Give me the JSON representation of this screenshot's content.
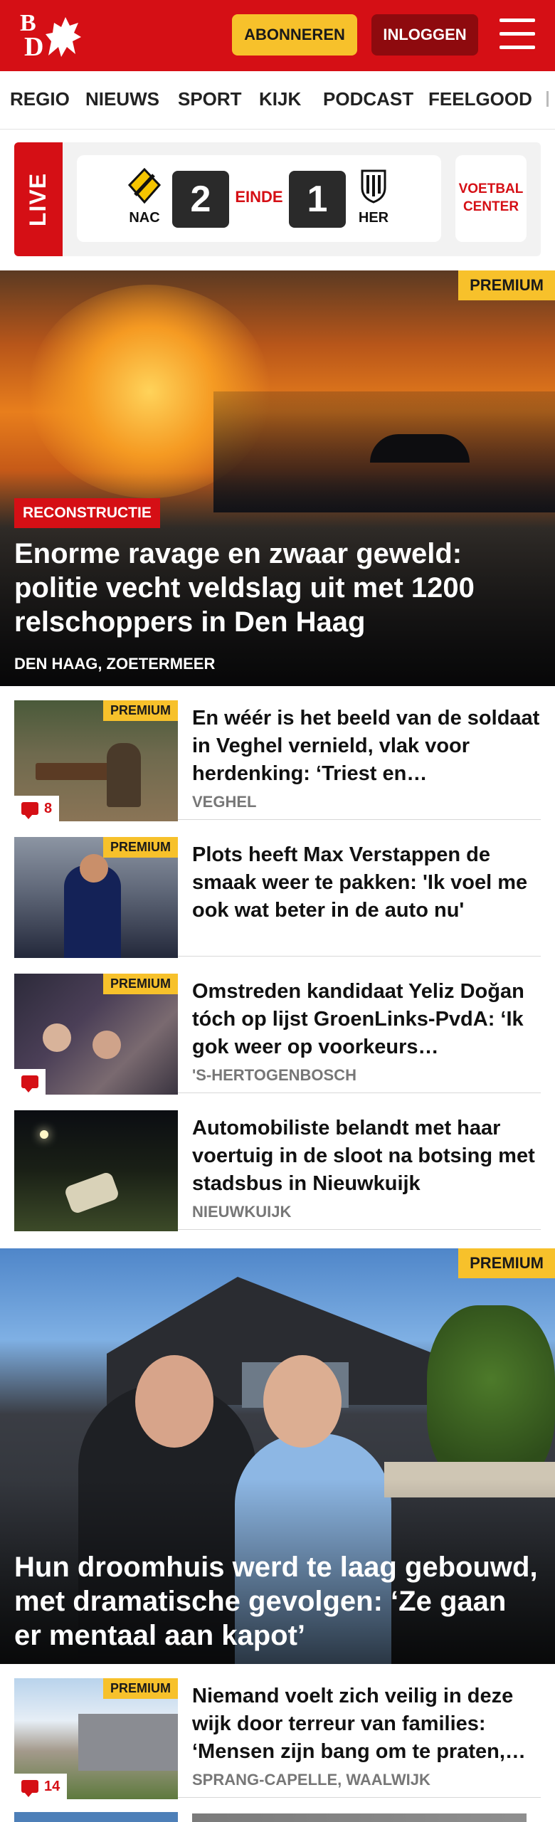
{
  "header": {
    "logo_b": "B",
    "logo_d": "D",
    "subscribe_label": "ABONNEREN",
    "login_label": "INLOGGEN",
    "brand_color": "#d50f15",
    "subscribe_color": "#f7c12b",
    "login_color": "#8e0a0e"
  },
  "nav": {
    "items": [
      "REGIO",
      "NIEUWS",
      "SPORT",
      "KIJK",
      "PODCAST",
      "FEELGOOD"
    ]
  },
  "live": {
    "label": "LIVE",
    "home_team": "NAC",
    "away_team": "HER",
    "home_score": "2",
    "away_score": "1",
    "status": "EINDE",
    "voetbal_center": "VOETBAL CENTER"
  },
  "hero1": {
    "premium": "PREMIUM",
    "tag": "RECONSTRUCTIE",
    "title": "Enorme ravage en zwaar geweld: politie vecht veldslag uit met 1200 relschoppers in Den Haag",
    "location": "DEN HAAG, ZOETERMEER"
  },
  "articles": [
    {
      "premium": "PREMIUM",
      "title": "En wéér is het beeld van de soldaat in Veghel vernield, vlak voor herdenking: ‘Triest en…",
      "location": "VEGHEL",
      "comments": "8"
    },
    {
      "premium": "PREMIUM",
      "title": "Plots heeft Max Verstappen de smaak weer te pakken: 'Ik voel me ook wat beter in de auto nu'",
      "location": "",
      "comments": ""
    },
    {
      "premium": "PREMIUM",
      "title": "Omstreden kandidaat Yeliz Doğan tóch op lijst GroenLinks-PvdA: ‘Ik gok weer op voorkeurs…",
      "location": "'S-HERTOGENBOSCH",
      "comments": ""
    },
    {
      "premium": "",
      "title": "Automobiliste belandt met haar voertuig in de sloot na botsing met stadsbus in Nieuwkuijk",
      "location": "NIEUWKUIJK",
      "comments": ""
    }
  ],
  "hero2": {
    "premium": "PREMIUM",
    "title": "Hun droomhuis werd te laag gebouwd, met dramatische gevolgen: ‘Ze gaan er mentaal aan kapot’"
  },
  "article_last": {
    "premium": "PREMIUM",
    "title": "Niemand voelt zich veilig in deze wijk door terreur van families: ‘Mensen zijn bang om te praten,…",
    "location": "SPRANG-CAPELLE, WAALWIJK",
    "comments": "14"
  }
}
